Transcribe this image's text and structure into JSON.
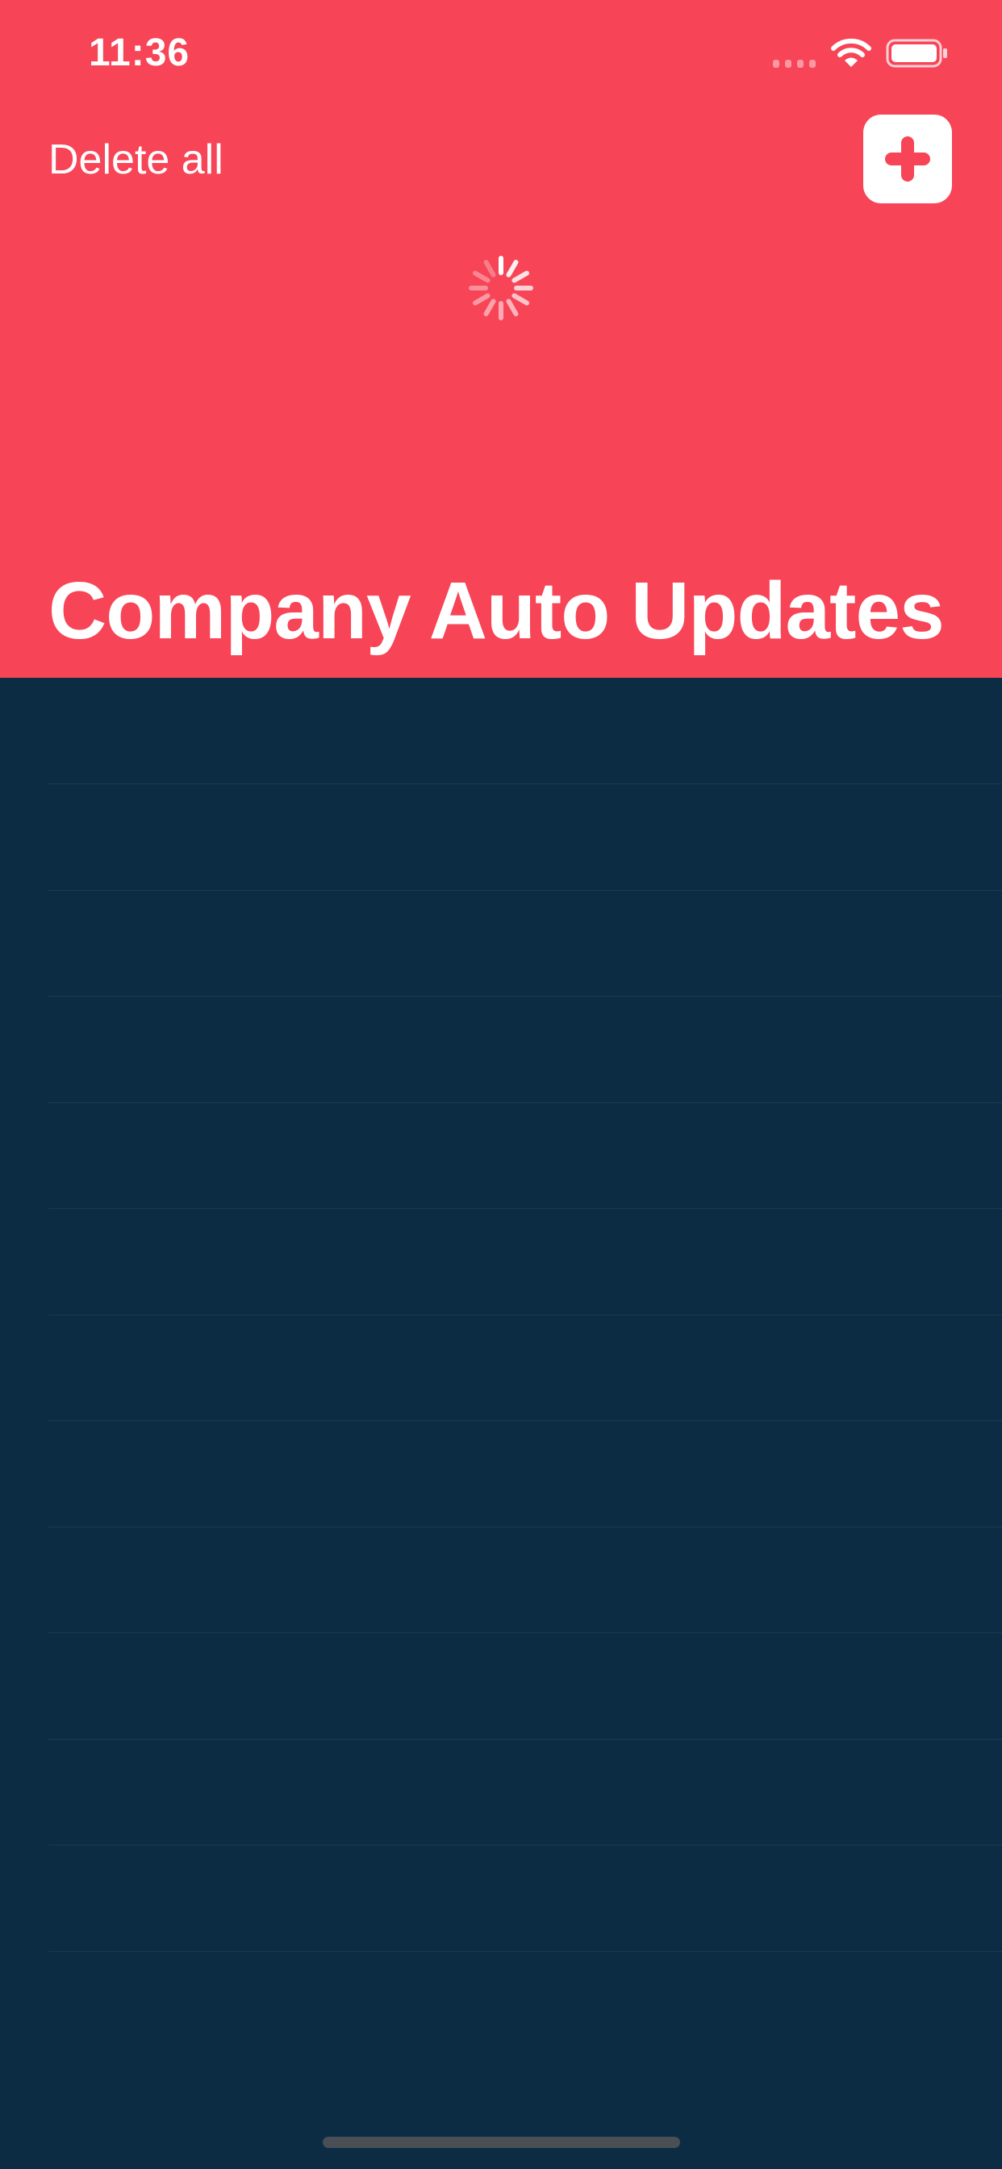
{
  "status_bar": {
    "time": "11:36",
    "signal_icon": "signal-dots-icon",
    "wifi_icon": "wifi-icon",
    "battery_icon": "battery-icon"
  },
  "nav": {
    "delete_all_label": "Delete all",
    "add_icon": "plus-icon"
  },
  "loading_indicator": "spinner-icon",
  "page": {
    "title": "Company Auto Updates"
  },
  "list": {
    "row_count": 12
  },
  "colors": {
    "header_background": "#f74457",
    "body_background": "#0b2c42",
    "accent": "#f74457",
    "text": "#ffffff"
  }
}
